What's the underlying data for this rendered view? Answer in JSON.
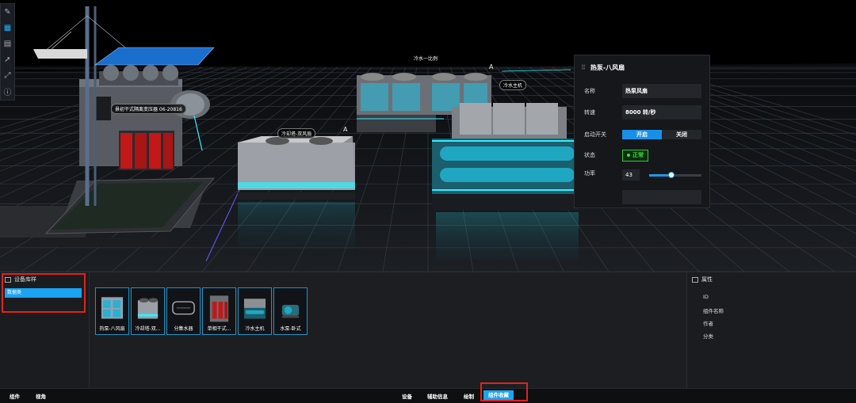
{
  "scene": {
    "labels": {
      "top_center": "冷水一比例",
      "dry_cooler": "冷却塔-双风扇",
      "chiller": "冷水主机",
      "transformer": "景初干式隔离变压器 06-20816"
    },
    "markers": [
      "A",
      "A"
    ]
  },
  "toolbar": {
    "icons": [
      "edit-icon",
      "grid-icon",
      "panel-icon",
      "arrow-icon",
      "expand-icon",
      "info-icon"
    ]
  },
  "property_panel": {
    "title": "热泵-八风扇",
    "rows": {
      "name_label": "名称",
      "name_value": "热泵风扇",
      "speed_label": "转速",
      "speed_value": "8000 转/秒",
      "switch_label": "启动开关",
      "switch_on": "开启",
      "switch_off": "关闭",
      "status_label": "状态",
      "status_value": "正常",
      "power_label": "功率",
      "power_value": "43"
    },
    "power_fraction": 0.43,
    "status_color": "#35e23a",
    "accent_color": "#1a8fe8"
  },
  "library": {
    "title": "设备库样",
    "items": [
      "数据类"
    ]
  },
  "components": [
    {
      "name": "热泵-八风扇"
    },
    {
      "name": "冷却塔-双..."
    },
    {
      "name": "分集水器"
    },
    {
      "name": "单相干式..."
    },
    {
      "name": "冷水主机"
    },
    {
      "name": "水泵-卧式"
    }
  ],
  "attributes": {
    "title": "属性",
    "items": [
      "ID",
      "组件名称",
      "作者",
      "分类"
    ]
  },
  "statusbar": {
    "left": [
      "组件",
      "视角"
    ],
    "center": [
      "设备",
      "辅助信息",
      "绘制",
      "组件收藏"
    ]
  },
  "highlight_color": "#e2231a"
}
